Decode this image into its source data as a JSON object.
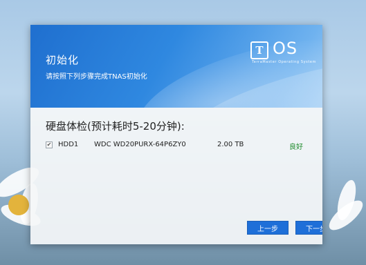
{
  "header": {
    "title": "初始化",
    "subtitle": "请按照下列步骤完成TNAS初始化"
  },
  "logo": {
    "mark": "T",
    "text": "OS",
    "tagline": "TerraMaster Operating System"
  },
  "content": {
    "section_title": "硬盘体检(预计耗时5-20分钟):",
    "disks": [
      {
        "checked": true,
        "name": "HDD1",
        "model": "WDC WD20PURX-64P6ZY0",
        "size": "2.00 TB",
        "status": "良好"
      }
    ]
  },
  "buttons": {
    "prev": "上一步",
    "next": "下一步"
  },
  "colors": {
    "accent": "#1e6fd8",
    "status_good": "#1c8a2a"
  },
  "icons": {
    "checkbox_checked": "✔"
  }
}
